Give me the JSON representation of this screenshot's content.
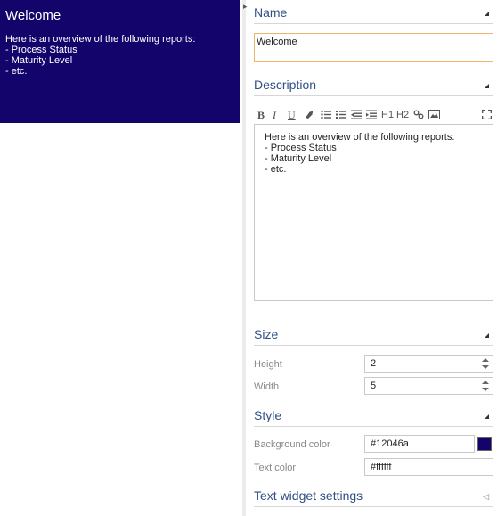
{
  "preview": {
    "title": "Welcome",
    "lines": [
      "Here is an overview of the following reports:",
      "- Process Status",
      "- Maturity Level",
      "- etc."
    ]
  },
  "name_section": {
    "title": "Name",
    "value": "Welcome"
  },
  "description_section": {
    "title": "Description",
    "toolbar": {
      "bold": "B",
      "italic": "I",
      "underline": "U",
      "h1": "H1",
      "h2": "H2"
    },
    "content_lines": [
      "Here is an overview of the following reports:",
      "- Process Status",
      "- Maturity Level",
      "- etc."
    ]
  },
  "size_section": {
    "title": "Size",
    "height_label": "Height",
    "height_value": "2",
    "width_label": "Width",
    "width_value": "5"
  },
  "style_section": {
    "title": "Style",
    "bg_label": "Background color",
    "bg_value": "#12046a",
    "text_color_label": "Text color",
    "text_color_value": "#ffffff"
  },
  "text_widget_section": {
    "title": "Text widget settings"
  },
  "colors": {
    "preview_background": "#12046a",
    "accent_title": "#2f4f86",
    "focus_border": "#f0b46a"
  }
}
